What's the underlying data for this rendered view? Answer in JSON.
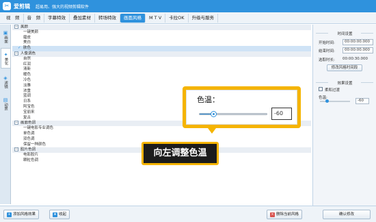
{
  "app": {
    "name": "爱剪辑",
    "slogan": "超易用、强大的视频剪辑软件"
  },
  "menu": [
    "视　频",
    "音　频",
    "字幕特效",
    "叠加素材",
    "转场特效",
    "画面风格",
    "M T V",
    "卡拉OK",
    "升级与服务"
  ],
  "menu_active": "画面风格",
  "sidebar": {
    "tabs": [
      {
        "label": "画面",
        "icon": "picture-icon"
      },
      {
        "label": "美化",
        "icon": "magic-wand-icon"
      },
      {
        "label": "滤镜",
        "icon": "filter-icon"
      },
      {
        "label": "动景",
        "icon": "motion-icon"
      }
    ]
  },
  "style_list": {
    "group_beauty": "美颜",
    "beauty_items": [
      "一键美颜",
      "磨皮",
      "美白",
      "肤色"
    ],
    "selected": "肤色",
    "group_portrait": "人像调色",
    "portrait_items": [
      "自然",
      "红润",
      "清新",
      "暖色",
      "冷色",
      "淡雅",
      "浓重",
      "蓝调",
      "日系",
      "阿宝色",
      "宝丽来",
      "复古"
    ],
    "group_screen": "画面色调",
    "screen_items": [
      "一键电影专业调色",
      "单色调",
      "双色调",
      "保留一种颜色"
    ],
    "group_film": "胶片色调",
    "film_items": [
      "电影胶片",
      "颗粒色调"
    ]
  },
  "toolbar": {
    "add_style": "添加风格效果",
    "favorite": "收起",
    "delete_style": "删除当前风格",
    "confirm": "确认修改"
  },
  "time_panel": {
    "title": "时间设置",
    "start_label": "开始时间:",
    "start_value": "00:00:00.000",
    "end_label": "结束时间:",
    "end_value": "00:00:00.000",
    "duration_label": "选取时长:",
    "duration_value": "00:00:30.000",
    "modify_button": "修改风格时间段"
  },
  "effect_panel": {
    "title": "效果设置",
    "soft_label": "柔和过渡",
    "color_temp_label": "色温:",
    "color_temp_value": "-60"
  },
  "popup": {
    "label": "色温：",
    "value": "-60"
  },
  "slider": {
    "min": -100,
    "max": 100,
    "value": -60
  },
  "callout": {
    "text": "向左调整色温"
  },
  "colors": {
    "accent": "#2f92dd",
    "highlight": "#f5b400"
  }
}
